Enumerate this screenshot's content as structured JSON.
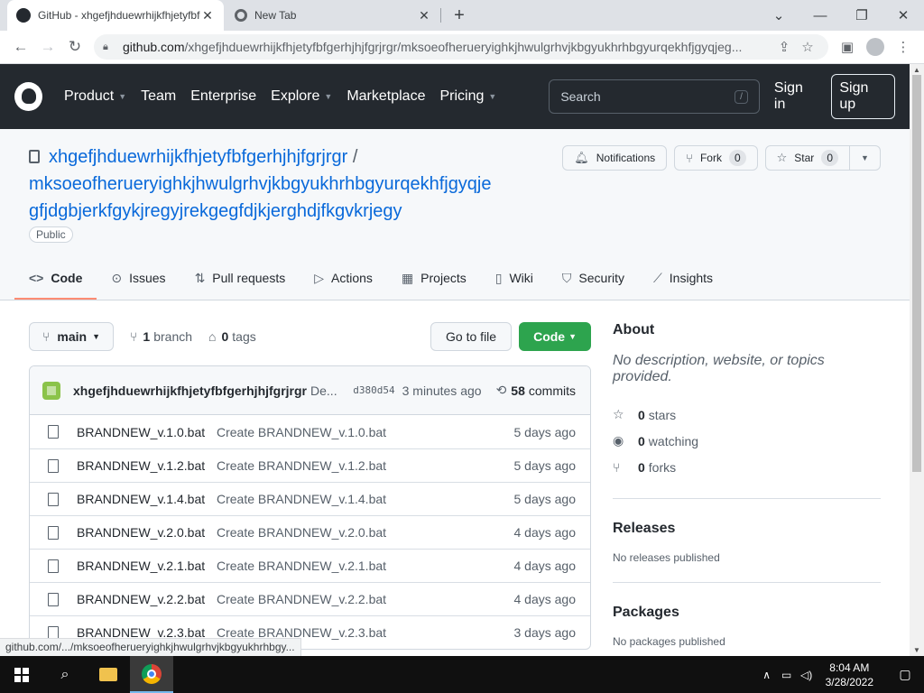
{
  "browser": {
    "tabs": [
      {
        "title": "GitHub - xhgefjhduewrhijkfhjetyfbfgerhjhjfgrjrgr/mksoeofherueryighkjhwulgrhvjkbgyukhrhbgyurqekhfjgyqjegfjdgbjerkfgykjregyjrekgegfdjkjerghdjfkgvkrjegy"
      },
      {
        "title": "New Tab"
      }
    ],
    "new_tab": "+",
    "url_host": "github.com",
    "url_path": "/xhgefjhduewrhijkfhjetyfbfgerhjhjfgrjrgr/mksoeofherueryighkjhwulgrhvjkbgyukhrhbgyurqekhfjgyqjeg..."
  },
  "github_header": {
    "nav": [
      {
        "label": "Product",
        "has_caret": true
      },
      {
        "label": "Team",
        "has_caret": false
      },
      {
        "label": "Enterprise",
        "has_caret": false
      },
      {
        "label": "Explore",
        "has_caret": true
      },
      {
        "label": "Marketplace",
        "has_caret": false
      },
      {
        "label": "Pricing",
        "has_caret": true
      }
    ],
    "search_placeholder": "Search",
    "search_key": "/",
    "sign_in": "Sign in",
    "sign_up": "Sign up"
  },
  "repo": {
    "owner": "xhgefjhduewrhijkfhjetyfbfgerhjhjfgrjrgr",
    "separator": "/",
    "name_line1": "mksoeofherueryighkjhwulgrhvjkbgyukhrhbgyurqekhfjgyqje",
    "name_line2": "gfjdgbjerkfgykjregyjrekgegfdjkjerghdjfkgvkrjegy",
    "visibility": "Public",
    "notifications_label": "Notifications",
    "fork_label": "Fork",
    "fork_count": "0",
    "star_label": "Star",
    "star_count": "0"
  },
  "repo_tabs": [
    {
      "label": "Code",
      "icon": "code-icon",
      "glyph": "<>",
      "selected": true
    },
    {
      "label": "Issues",
      "icon": "issue-icon",
      "glyph": "⊙",
      "selected": false
    },
    {
      "label": "Pull requests",
      "icon": "pull-request-icon",
      "glyph": "⇅",
      "selected": false
    },
    {
      "label": "Actions",
      "icon": "play-icon",
      "glyph": "▷",
      "selected": false
    },
    {
      "label": "Projects",
      "icon": "table-icon",
      "glyph": "▦",
      "selected": false
    },
    {
      "label": "Wiki",
      "icon": "book-icon",
      "glyph": "▯",
      "selected": false
    },
    {
      "label": "Security",
      "icon": "shield-icon",
      "glyph": "⛉",
      "selected": false
    },
    {
      "label": "Insights",
      "icon": "graph-icon",
      "glyph": "⟋",
      "selected": false
    }
  ],
  "toolbar": {
    "branch": "main",
    "branch_count": "1",
    "branch_word": "branch",
    "tag_count": "0",
    "tag_word": "tags",
    "go_to_file": "Go to file",
    "code_button": "Code"
  },
  "latest_commit": {
    "author": "xhgefjhduewrhijkfhjetyfbfgerhjhjfgrjrgr",
    "message": "De...",
    "sha": "d380d54",
    "time": "3 minutes ago",
    "count": "58",
    "count_word": "commits"
  },
  "files": [
    {
      "name": "BRANDNEW_v.1.0.bat",
      "message": "Create BRANDNEW_v.1.0.bat",
      "age": "5 days ago"
    },
    {
      "name": "BRANDNEW_v.1.2.bat",
      "message": "Create BRANDNEW_v.1.2.bat",
      "age": "5 days ago"
    },
    {
      "name": "BRANDNEW_v.1.4.bat",
      "message": "Create BRANDNEW_v.1.4.bat",
      "age": "5 days ago"
    },
    {
      "name": "BRANDNEW_v.2.0.bat",
      "message": "Create BRANDNEW_v.2.0.bat",
      "age": "4 days ago"
    },
    {
      "name": "BRANDNEW_v.2.1.bat",
      "message": "Create BRANDNEW_v.2.1.bat",
      "age": "4 days ago"
    },
    {
      "name": "BRANDNEW_v.2.2.bat",
      "message": "Create BRANDNEW_v.2.2.bat",
      "age": "4 days ago"
    },
    {
      "name": "BRANDNEW_v.2.3.bat",
      "message": "Create BRANDNEW_v.2.3.bat",
      "age": "3 days ago"
    }
  ],
  "about": {
    "heading": "About",
    "description": "No description, website, or topics provided.",
    "stars_count": "0",
    "stars_word": "stars",
    "watching_count": "0",
    "watching_word": "watching",
    "forks_count": "0",
    "forks_word": "forks"
  },
  "releases": {
    "heading": "Releases",
    "text": "No releases published"
  },
  "packages": {
    "heading": "Packages",
    "text": "No packages published"
  },
  "status_bubble": "github.com/.../mksoeofherueryighkjhwulgrhvjkbgyukhrhbgy...",
  "taskbar": {
    "time": "8:04 AM",
    "date": "3/28/2022"
  },
  "colors": {
    "header_bg": "#24292f",
    "link": "#0969da",
    "code_button": "#2da44e",
    "tab_underline": "#fd8c73"
  }
}
